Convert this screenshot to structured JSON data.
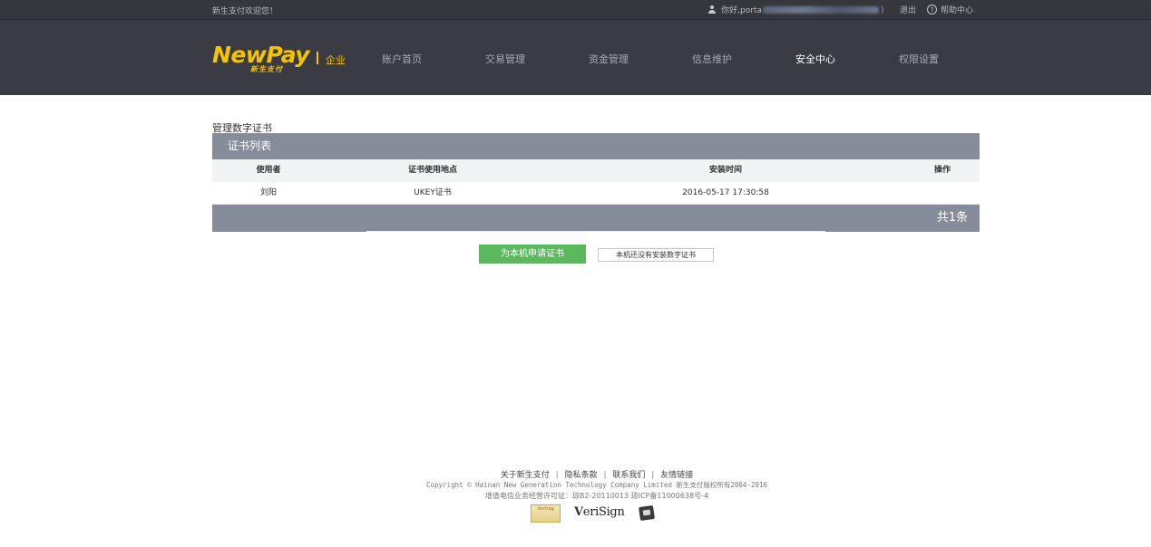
{
  "topbar": {
    "welcome": "新生支付欢迎您！",
    "greeting_prefix": "你好,porta",
    "paren_close": "）",
    "logout": "退出",
    "help_icon_glyph": "?",
    "help": "帮助中心"
  },
  "brand": {
    "logo_text": "NewPay",
    "logo_sub": "新生支付",
    "tag": "企业",
    "accent": "#f5c400"
  },
  "nav": {
    "items": [
      {
        "label": "账户首页",
        "active": false
      },
      {
        "label": "交易管理",
        "active": false
      },
      {
        "label": "资金管理",
        "active": false
      },
      {
        "label": "信息维护",
        "active": false
      },
      {
        "label": "安全中心",
        "active": true
      },
      {
        "label": "权限设置",
        "active": false
      }
    ]
  },
  "main": {
    "title": "管理数字证书",
    "table": {
      "caption": "证书列表",
      "columns": [
        "使用者",
        "证书使用地点",
        "安装时间",
        "操作"
      ],
      "rows": [
        {
          "user": "刘阳",
          "location": "UKEY证书",
          "installed": "2016-05-17 17:30:58",
          "action": ""
        }
      ],
      "total": "共1条"
    },
    "apply_button": "为本机申请证书",
    "no_cert_button": "本机还没有安装数字证书"
  },
  "footer": {
    "links": [
      "关于新生支付",
      "隐私条款",
      "联系我们",
      "友情链接"
    ],
    "separator": "|",
    "copyright": "Copyright © Hainan New Generation Technology Company Limited 新生支付版权所有2004-2016",
    "license": "增值电信业务经营许可证：琼B2-20110013 琼ICP备11000638号-4",
    "badges": {
      "badge1": "Vertrag",
      "verisign": "eriSign",
      "verisign_check": "V"
    }
  }
}
